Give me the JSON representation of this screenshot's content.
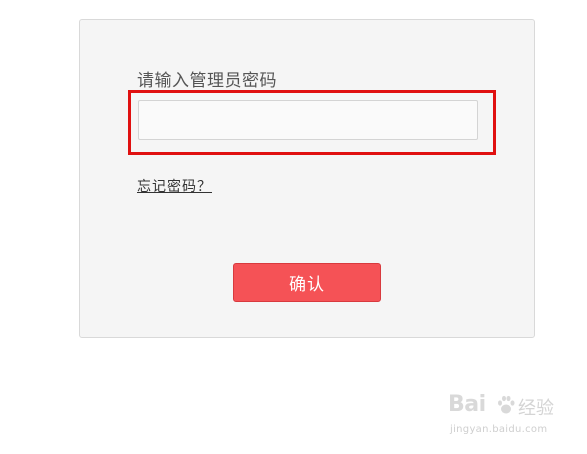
{
  "login": {
    "prompt_label": "请输入管理员密码",
    "password_value": "",
    "forgot_link": "忘记密码？",
    "confirm_label": "确认"
  },
  "watermark": {
    "logo": "Bai",
    "logo_suffix": "经验",
    "url": "jingyan.baidu.com"
  },
  "colors": {
    "panel_background": "#f5f5f5",
    "highlight_border": "#e01010",
    "confirm_button": "#f55256"
  },
  "icons": {
    "paw": "paw-icon"
  }
}
